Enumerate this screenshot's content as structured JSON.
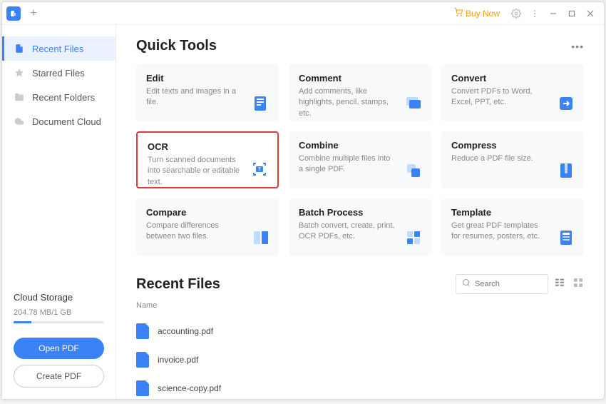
{
  "titlebar": {
    "buy_now": "Buy Now"
  },
  "sidebar": {
    "items": [
      {
        "label": "Recent Files"
      },
      {
        "label": "Starred Files"
      },
      {
        "label": "Recent Folders"
      },
      {
        "label": "Document Cloud"
      }
    ],
    "storage": {
      "label": "Cloud Storage",
      "value": "204.78 MB/1 GB"
    },
    "buttons": {
      "open": "Open PDF",
      "create": "Create PDF"
    }
  },
  "quick_tools": {
    "title": "Quick Tools",
    "tools": [
      {
        "title": "Edit",
        "desc": "Edit texts and images in a file."
      },
      {
        "title": "Comment",
        "desc": "Add comments, like highlights, pencil, stamps, etc."
      },
      {
        "title": "Convert",
        "desc": "Convert PDFs to Word, Excel, PPT, etc."
      },
      {
        "title": "OCR",
        "desc": "Turn scanned documents into searchable or editable text."
      },
      {
        "title": "Combine",
        "desc": "Combine multiple files into a single PDF."
      },
      {
        "title": "Compress",
        "desc": "Reduce a PDF file size."
      },
      {
        "title": "Compare",
        "desc": "Compare differences between two files."
      },
      {
        "title": "Batch Process",
        "desc": "Batch convert, create, print, OCR PDFs, etc."
      },
      {
        "title": "Template",
        "desc": "Get great PDF templates for resumes, posters, etc."
      }
    ]
  },
  "recent": {
    "title": "Recent Files",
    "search_placeholder": "Search",
    "col_name": "Name",
    "files": [
      {
        "name": "accounting.pdf"
      },
      {
        "name": "invoice.pdf"
      },
      {
        "name": "science-copy.pdf"
      }
    ]
  }
}
